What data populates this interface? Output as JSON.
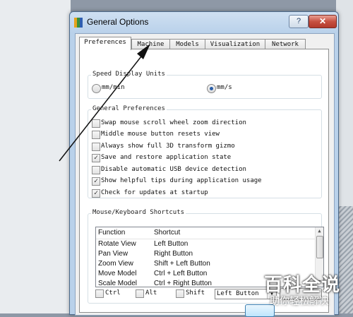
{
  "window": {
    "title": "General Options",
    "help_label": "?",
    "close_label": "✕",
    "app_icon_colors": [
      "#e6a21b",
      "#3a8f3a",
      "#2f5fb0"
    ]
  },
  "tabs": [
    {
      "label": "Preferences",
      "active": true
    },
    {
      "label": "Machine",
      "active": false
    },
    {
      "label": "Models",
      "active": false
    },
    {
      "label": "Visualization",
      "active": false
    },
    {
      "label": "Network",
      "active": false
    }
  ],
  "speed_units": {
    "label": "Speed Display Units",
    "options": [
      {
        "label": "mm/min",
        "selected": false
      },
      {
        "label": "mm/s",
        "selected": true
      }
    ]
  },
  "general": {
    "label": "General Preferences",
    "items": [
      {
        "label": "Swap mouse scroll wheel zoom direction",
        "checked": false
      },
      {
        "label": "Middle mouse button resets view",
        "checked": false
      },
      {
        "label": "Always show full 3D transform gizmo",
        "checked": false
      },
      {
        "label": "Save and restore application state",
        "checked": true
      },
      {
        "label": "Disable automatic USB device detection",
        "checked": false
      },
      {
        "label": "Show helpful tips during application usage",
        "checked": true
      },
      {
        "label": "Check for updates at startup",
        "checked": true
      }
    ]
  },
  "shortcuts": {
    "label": "Mouse/Keyboard Shortcuts",
    "columns": [
      "Function",
      "Shortcut"
    ],
    "rows": [
      [
        "Rotate View",
        "Left Button"
      ],
      [
        "Pan View",
        "Right Button"
      ],
      [
        "Zoom View",
        "Shift + Left Button"
      ],
      [
        "Move Model",
        "Ctrl + Left Button"
      ],
      [
        "Scale Model",
        "Ctrl + Right Button"
      ]
    ],
    "modifiers": [
      {
        "label": "Ctrl",
        "checked": false
      },
      {
        "label": "Alt",
        "checked": false
      },
      {
        "label": "Shift",
        "checked": false
      }
    ],
    "button_select": "Left Button"
  },
  "watermark": {
    "main": "百科全说",
    "sub": "助你轻松解决"
  },
  "colors": {
    "check_color": "#333333",
    "annotation_arrow": "#111111"
  }
}
